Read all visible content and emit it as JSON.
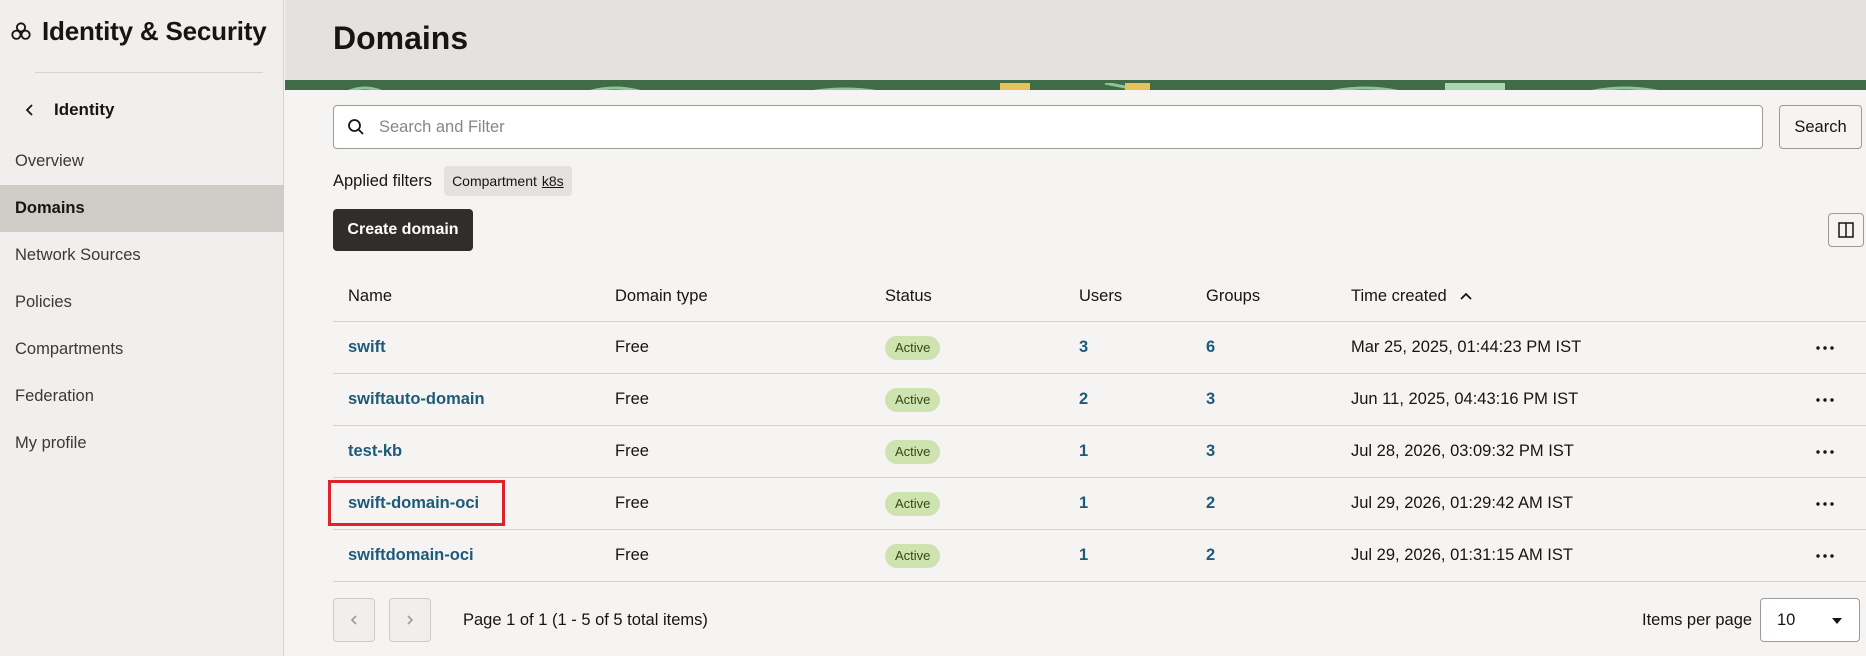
{
  "sidebar": {
    "brand_title": "Identity & Security",
    "back_label": "Identity",
    "items": [
      {
        "label": "Overview",
        "active": false
      },
      {
        "label": "Domains",
        "active": true
      },
      {
        "label": "Network Sources",
        "active": false
      },
      {
        "label": "Policies",
        "active": false
      },
      {
        "label": "Compartments",
        "active": false
      },
      {
        "label": "Federation",
        "active": false
      },
      {
        "label": "My profile",
        "active": false
      }
    ]
  },
  "header": {
    "title": "Domains"
  },
  "search": {
    "placeholder": "Search and Filter",
    "button_label": "Search"
  },
  "filters": {
    "label": "Applied filters",
    "chip_key": "Compartment",
    "chip_value": "k8s"
  },
  "toolbar": {
    "create_label": "Create domain"
  },
  "table": {
    "columns": [
      "Name",
      "Domain type",
      "Status",
      "Users",
      "Groups",
      "Time created"
    ],
    "sort_column": "Time created",
    "sort_direction": "ascending",
    "rows": [
      {
        "name": "swift",
        "type": "Free",
        "status": "Active",
        "users": "3",
        "groups": "6",
        "time": "Mar 25, 2025, 01:44:23 PM IST"
      },
      {
        "name": "swiftauto-domain",
        "type": "Free",
        "status": "Active",
        "users": "2",
        "groups": "3",
        "time": "Jun 11, 2025, 04:43:16 PM IST"
      },
      {
        "name": "test-kb",
        "type": "Free",
        "status": "Active",
        "users": "1",
        "groups": "3",
        "time": "Jul 28, 2026, 03:09:32 PM IST"
      },
      {
        "name": "swift-domain-oci",
        "type": "Free",
        "status": "Active",
        "users": "1",
        "groups": "2",
        "time": "Jul 29, 2026, 01:29:42 AM IST"
      },
      {
        "name": "swiftdomain-oci",
        "type": "Free",
        "status": "Active",
        "users": "1",
        "groups": "2",
        "time": "Jul 29, 2026, 01:31:15 AM IST"
      }
    ]
  },
  "pagination": {
    "info": "Page 1 of 1 (1 - 5 of 5 total items)",
    "items_per_page_label": "Items per page",
    "items_per_page_value": "10"
  },
  "colors": {
    "link": "#1d5b79",
    "primary_button": "#312d2a",
    "status_badge": "#cfe3b0",
    "highlight": "#e0232b"
  },
  "icons": {
    "brand": "oci-logo-icon",
    "back": "chevron-left-icon",
    "search": "search-icon",
    "columns": "columns-icon",
    "sort": "sort-up-icon",
    "row_actions": "kebab-icon",
    "prev": "chevron-left-icon",
    "next": "chevron-right-icon",
    "dropdown": "caret-down-icon"
  }
}
